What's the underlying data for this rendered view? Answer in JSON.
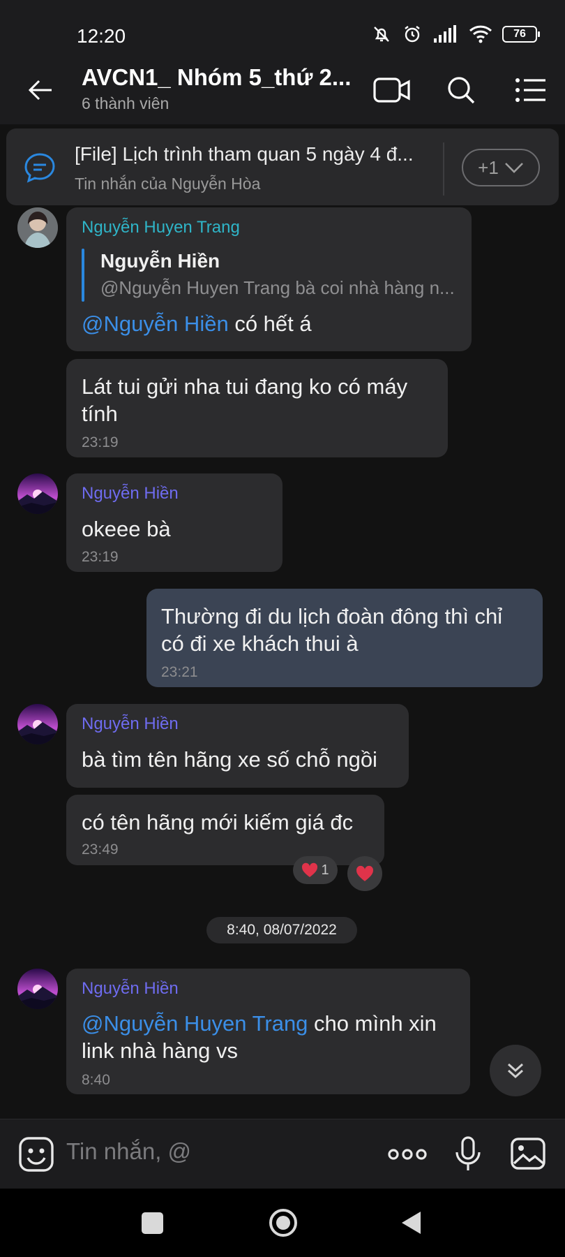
{
  "status_bar": {
    "time": "12:20",
    "battery": "76"
  },
  "header": {
    "title": "AVCN1_ Nhóm 5_thứ 2...",
    "member_count": "6 thành viên"
  },
  "pinned": {
    "title": "[File] Lịch trình tham quan 5 ngày 4 đ...",
    "subtitle": "Tin nhắn của Nguyễn Hòa",
    "count": "+1"
  },
  "messages": [
    {
      "sender": "Nguyễn Huyen Trang",
      "reply_to_sender": "Nguyễn Hiền",
      "reply_to_text": "@Nguyễn Huyen Trang bà coi nhà hàng n...",
      "mention": "@Nguyễn Hiền",
      "text": " có hết á"
    },
    {
      "text_line1": "Lát tui gửi nha tui đang ko có máy",
      "text_line2": "tính",
      "time": "23:19"
    },
    {
      "sender": "Nguyễn Hiền",
      "text": "okeee bà",
      "time": "23:19"
    },
    {
      "text_line1": "Thường đi du lịch đoàn đông thì chỉ",
      "text_line2": "có đi xe khách thui à",
      "time": "23:21"
    },
    {
      "sender": "Nguyễn Hiền",
      "text": "bà tìm tên hãng xe số chỗ ngồi"
    },
    {
      "text": "có tên hãng mới kiếm giá đc",
      "time": "23:49",
      "reaction_count": "1"
    },
    {
      "sender": "Nguyễn Hiền",
      "mention": "@Nguyễn Huyen Trang",
      "text_line1": " cho mình xin",
      "text_line2": "link nhà hàng vs",
      "time": "8:40"
    }
  ],
  "date_separator": "8:40, 08/07/2022",
  "composer": {
    "placeholder": "Tin nhắn, @"
  },
  "colors": {
    "mention": "#3b8fe8",
    "sender_teal": "#2fb5c8",
    "sender_purple": "#6f6cf0",
    "accent": "#2a88e0"
  }
}
